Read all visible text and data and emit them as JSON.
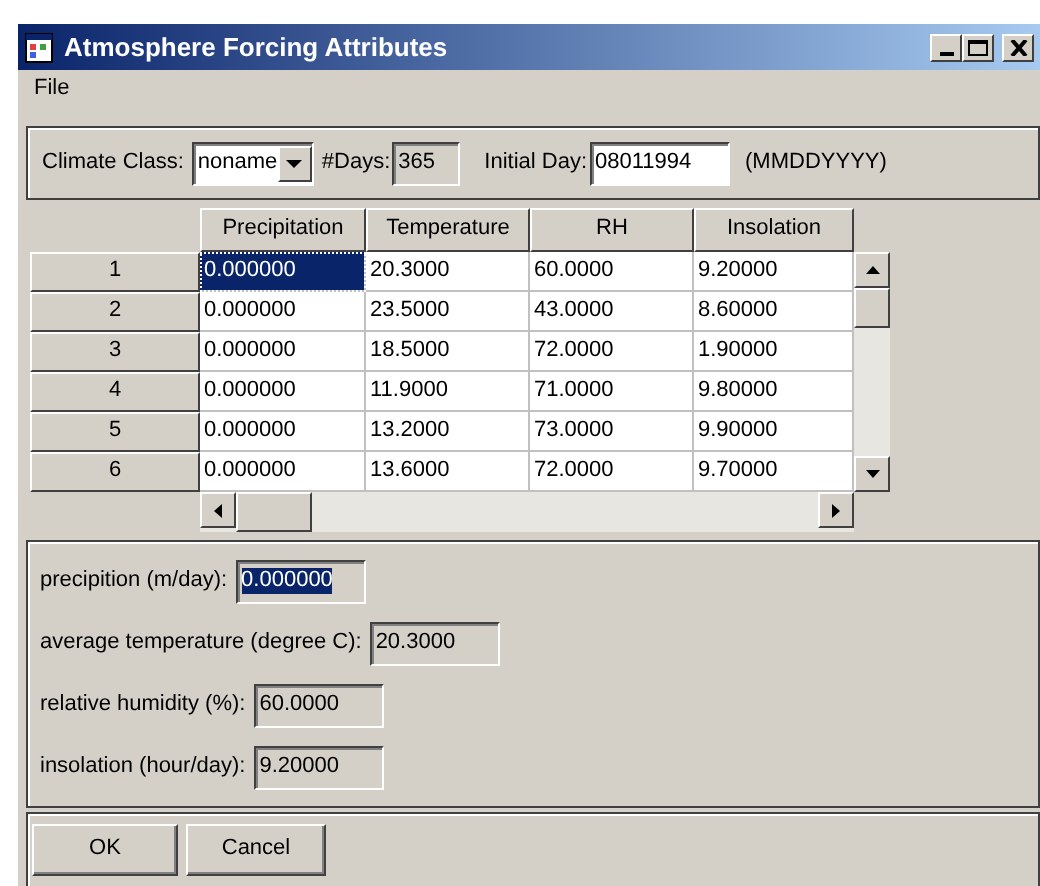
{
  "window": {
    "title": "Atmosphere Forcing Attributes"
  },
  "menu": [
    "File"
  ],
  "settings": {
    "climate_class_label": "Climate Class:",
    "climate_class": "noname",
    "days_label": "#Days:",
    "days": "365",
    "initial_day_label": "Initial Day:",
    "initial_day": "08011994",
    "date_format": "(MMDDYYYY)"
  },
  "table": {
    "columns": [
      "Precipitation",
      "Temperature",
      "RH",
      "Insolation"
    ],
    "rows": [
      {
        "header": "1",
        "cells": [
          "0.000000",
          "20.3000",
          "60.0000",
          "9.20000"
        ],
        "selected": true
      },
      {
        "header": "2",
        "cells": [
          "0.000000",
          "23.5000",
          "43.0000",
          "8.60000"
        ],
        "selected": false
      },
      {
        "header": "3",
        "cells": [
          "0.000000",
          "18.5000",
          "72.0000",
          "1.90000"
        ],
        "selected": false
      },
      {
        "header": "4",
        "cells": [
          "0.000000",
          "11.9000",
          "71.0000",
          "9.80000"
        ],
        "selected": false
      },
      {
        "header": "5",
        "cells": [
          "0.000000",
          "13.2000",
          "73.0000",
          "9.90000"
        ],
        "selected": false
      },
      {
        "header": "6",
        "cells": [
          "0.000000",
          "13.6000",
          "72.0000",
          "9.70000"
        ],
        "selected": false
      }
    ]
  },
  "details": [
    {
      "label": "precipition (m/day):",
      "value": "0.000000",
      "selected": true
    },
    {
      "label": "average temperature (degree C):",
      "value": "20.3000",
      "selected": false
    },
    {
      "label": "relative humidity (%):",
      "value": "60.0000",
      "selected": false
    },
    {
      "label": "insolation (hour/day):",
      "value": "9.20000",
      "selected": false
    }
  ],
  "buttons": [
    "OK",
    "Cancel"
  ]
}
